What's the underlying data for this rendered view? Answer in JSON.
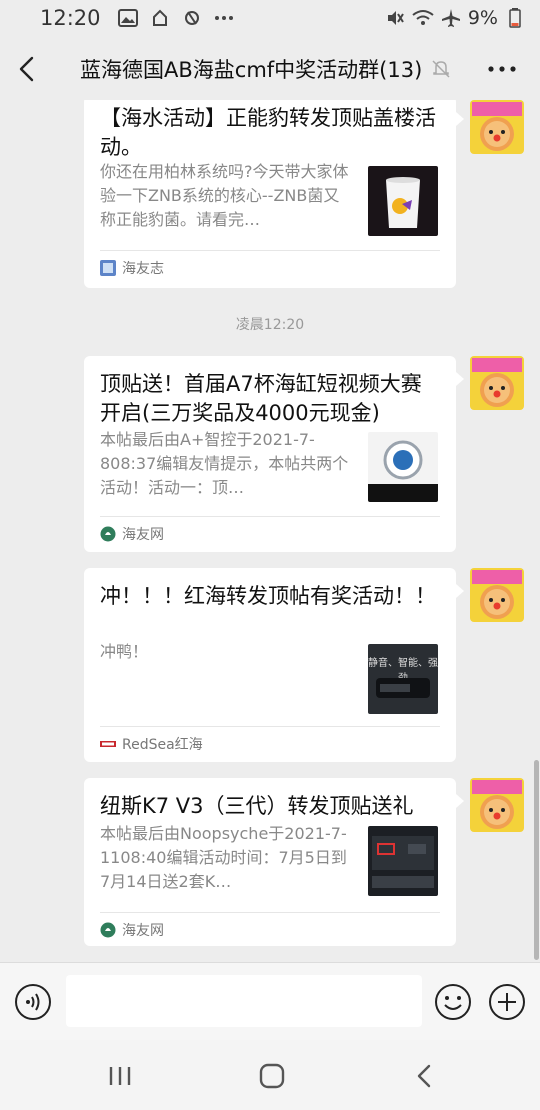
{
  "status": {
    "time": "12:20",
    "battery": "9%"
  },
  "header": {
    "title": "蓝海德国AB海盐cmf中奖活动群(13)",
    "back_icon": "chevron-left-icon",
    "more_icon": "more-icon"
  },
  "messages": [
    {
      "title": "【海水活动】正能豹转发顶贴盖楼活动。",
      "desc": "你还在用柏林系统吗?今天带大家体验一下ZNB系统的核心--ZNB菌又称正能豹菌。请看完…",
      "source": "海友志",
      "thumb": "bucket-product-image"
    },
    {
      "title": "顶贴送！首届A7杯海缸短视频大赛开启(三万奖品及4000元现金)",
      "desc": "本帖最后由A+智控于2021-7-808:37编辑友情提示，本帖共两个活动！活动一：顶…",
      "source": "海友网",
      "thumb": "a7-logo-image"
    },
    {
      "title": "冲！！！红海转发顶帖有奖活动！！",
      "desc": "冲鸭！",
      "source": "RedSea红海",
      "thumb": "pump-product-image",
      "thumb_text": "静音、智能、强劲"
    },
    {
      "title": "纽斯K7 V3（三代）转发顶贴送礼",
      "desc": "本帖最后由Noopsyche于2021-7-1108:40编辑活动时间：7月5日到7月14日送2套K…",
      "source": "海友网",
      "thumb": "k7-device-image"
    }
  ],
  "timestamp": "凌晨12:20",
  "input": {
    "placeholder": ""
  },
  "colors": {
    "background": "#ededed",
    "card": "#ffffff",
    "source_green": "#2f7d5b"
  }
}
